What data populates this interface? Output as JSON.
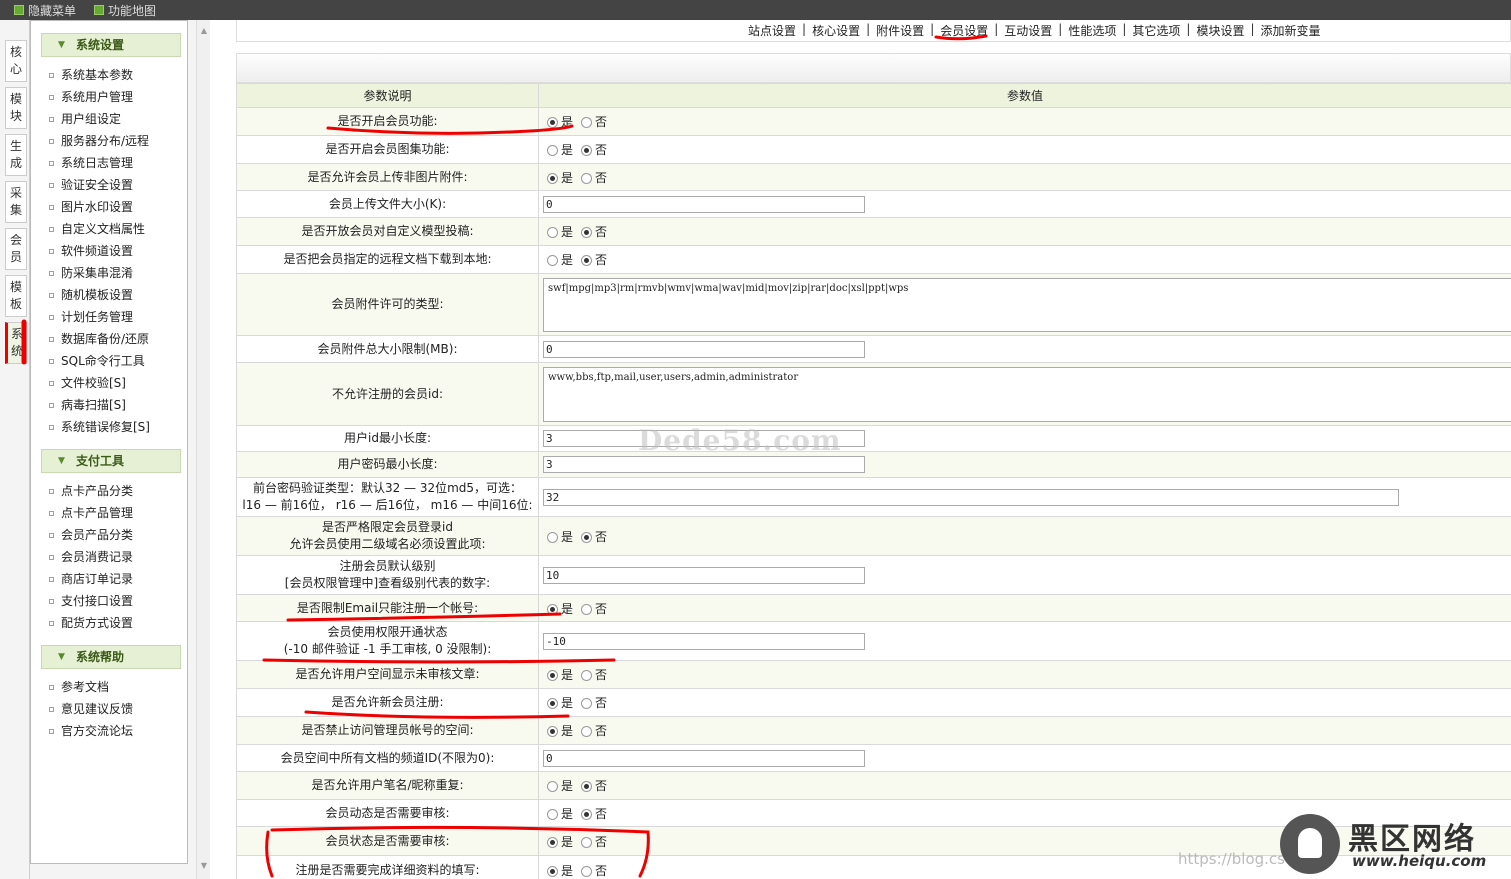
{
  "topbar": {
    "items": [
      {
        "label": "隐藏菜单"
      },
      {
        "label": "功能地图"
      }
    ]
  },
  "vtabs": [
    {
      "label": "核心"
    },
    {
      "label": "模块"
    },
    {
      "label": "生成"
    },
    {
      "label": "采集"
    },
    {
      "label": "会员"
    },
    {
      "label": "模板"
    },
    {
      "label": "系统",
      "active": true
    }
  ],
  "sidebar": {
    "groups": [
      {
        "title": "系统设置",
        "items": [
          "系统基本参数",
          "系统用户管理",
          "用户组设定",
          "服务器分布/远程",
          "系统日志管理",
          "验证安全设置",
          "图片水印设置",
          "自定义文档属性",
          "软件频道设置",
          "防采集串混淆",
          "随机模板设置",
          "计划任务管理",
          "数据库备份/还原",
          "SQL命令行工具",
          "文件校验[S]",
          "病毒扫描[S]",
          "系统错误修复[S]"
        ]
      },
      {
        "title": "支付工具",
        "items": [
          "点卡产品分类",
          "点卡产品管理",
          "会员产品分类",
          "会员消费记录",
          "商店订单记录",
          "支付接口设置",
          "配货方式设置"
        ]
      },
      {
        "title": "系统帮助",
        "items": [
          "参考文档",
          "意见建议反馈",
          "官方交流论坛"
        ]
      }
    ]
  },
  "topnav": {
    "items": [
      "站点设置",
      "核心设置",
      "附件设置",
      "会员设置",
      "互动设置",
      "性能选项",
      "其它选项",
      "模块设置",
      "添加新变量"
    ],
    "active": "会员设置"
  },
  "table": {
    "headers": {
      "label": "参数说明",
      "value": "参数值"
    },
    "yes": "是",
    "no": "否",
    "rows": [
      {
        "label": "是否开启会员功能:",
        "type": "radio",
        "value": "yes"
      },
      {
        "label": "是否开启会员图集功能:",
        "type": "radio",
        "value": "no"
      },
      {
        "label": "是否允许会员上传非图片附件:",
        "type": "radio",
        "value": "yes"
      },
      {
        "label": "会员上传文件大小(K):",
        "type": "text",
        "value": "0"
      },
      {
        "label": "是否开放会员对自定义模型投稿:",
        "type": "radio",
        "value": "no"
      },
      {
        "label": "是否把会员指定的远程文档下载到本地:",
        "type": "radio",
        "value": "no"
      },
      {
        "label": "会员附件许可的类型:",
        "type": "textarea",
        "value": "swf|mpg|mp3|rm|rmvb|wmv|wma|wav|mid|mov|zip|rar|doc|xsl|ppt|wps"
      },
      {
        "label": "会员附件总大小限制(MB):",
        "type": "text",
        "value": "0"
      },
      {
        "label": "不允许注册的会员id:",
        "type": "textarea",
        "value": "www,bbs,ftp,mail,user,users,admin,administrator"
      },
      {
        "label": "用户id最小长度:",
        "type": "text",
        "value": "3"
      },
      {
        "label": "用户密码最小长度:",
        "type": "text",
        "value": "3"
      },
      {
        "label": "前台密码验证类型：默认32 — 32位md5，可选：",
        "label2": "l16 — 前16位， r16 — 后16位， m16 — 中间16位:",
        "type": "text-wide",
        "value": "32"
      },
      {
        "label": "是否严格限定会员登录id",
        "label2": "允许会员使用二级域名必须设置此项:",
        "type": "radio",
        "value": "no"
      },
      {
        "label": "注册会员默认级别",
        "label2": "[会员权限管理中]查看级别代表的数字:",
        "type": "text",
        "value": "10"
      },
      {
        "label": "是否限制Email只能注册一个帐号:",
        "type": "radio",
        "value": "yes"
      },
      {
        "label": "会员使用权限开通状态",
        "label2": "(-10 邮件验证 -1 手工审核, 0 没限制):",
        "type": "text",
        "value": "-10"
      },
      {
        "label": "是否允许用户空间显示未审核文章:",
        "type": "radio",
        "value": "yes"
      },
      {
        "label": "是否允许新会员注册:",
        "type": "radio",
        "value": "yes"
      },
      {
        "label": "是否禁止访问管理员帐号的空间:",
        "type": "radio",
        "value": "yes"
      },
      {
        "label": "会员空间中所有文档的频道ID(不限为0):",
        "type": "text",
        "value": "0"
      },
      {
        "label": "是否允许用户笔名/昵称重复:",
        "type": "radio",
        "value": "no"
      },
      {
        "label": "会员动态是否需要审核:",
        "type": "radio",
        "value": "no"
      },
      {
        "label": "会员状态是否需要审核:",
        "type": "radio",
        "value": "yes"
      },
      {
        "label": "注册是否需要完成详细资料的填写:",
        "type": "radio",
        "value": "yes"
      }
    ]
  },
  "watermark": "Dede58.com",
  "brand": {
    "name": "黑区网络",
    "url": "www.heiqu.com"
  },
  "blog_url": "https://blog.csdn.net",
  "colors": {
    "accent_green": "#e6f0d4",
    "annotation_red": "#e00000",
    "header_bg": "#444444"
  }
}
